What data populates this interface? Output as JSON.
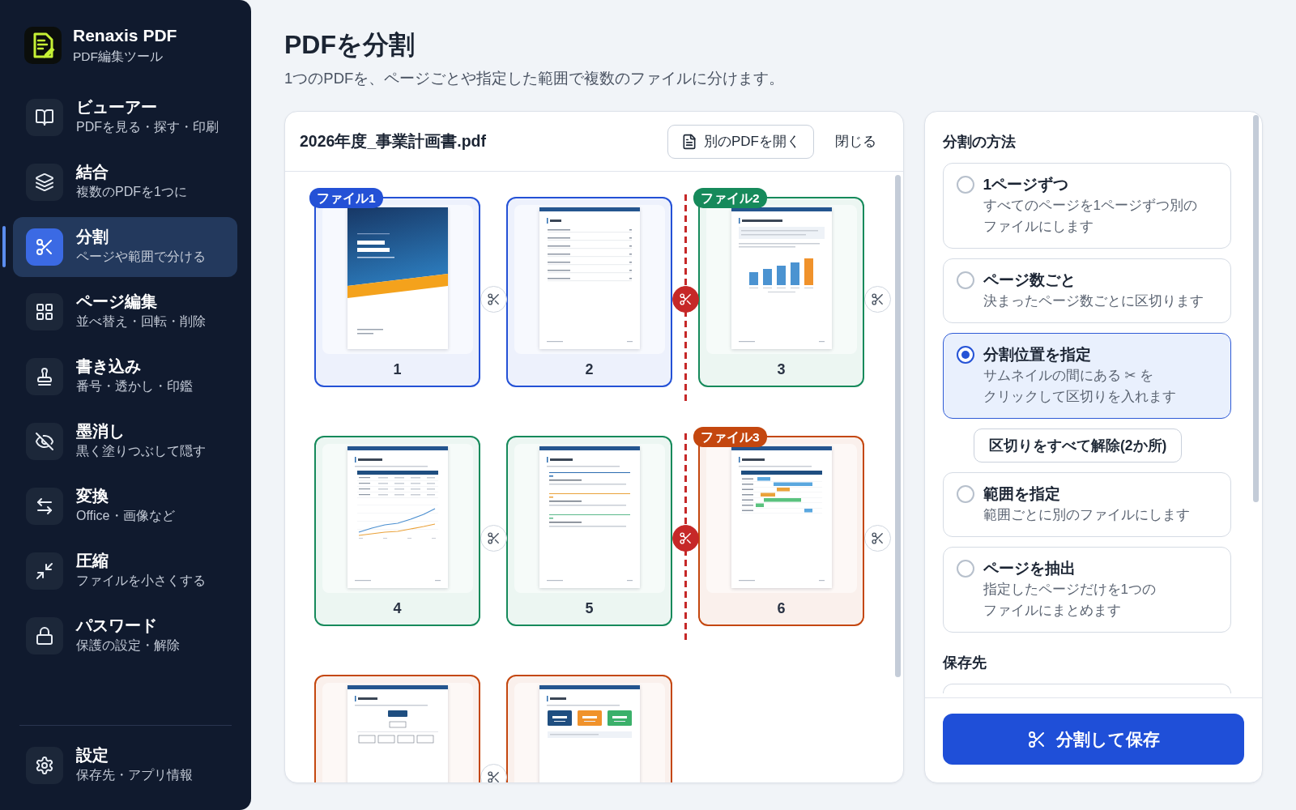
{
  "sidebar": {
    "app_name": "Renaxis PDF",
    "tagline": "PDF編集ツール",
    "items": [
      {
        "title": "ビューアー",
        "subtitle": "PDFを見る・探す・印刷",
        "selected": false
      },
      {
        "title": "結合",
        "subtitle": "複数のPDFを1つに",
        "selected": false
      },
      {
        "title": "分割",
        "subtitle": "ページや範囲で分ける",
        "selected": true
      },
      {
        "title": "ページ編集",
        "subtitle": "並べ替え・回転・削除",
        "selected": false
      },
      {
        "title": "書き込み",
        "subtitle": "番号・透かし・印鑑",
        "selected": false
      },
      {
        "title": "墨消し",
        "subtitle": "黒く塗りつぶして隠す",
        "selected": false
      },
      {
        "title": "変換",
        "subtitle": "Office・画像など",
        "selected": false
      },
      {
        "title": "圧縮",
        "subtitle": "ファイルを小さくする",
        "selected": false
      },
      {
        "title": "パスワード",
        "subtitle": "保護の設定・解除",
        "selected": false
      }
    ],
    "footer_item": {
      "title": "設定",
      "subtitle": "保存先・アプリ情報",
      "selected": false
    }
  },
  "header": {
    "title": "PDFを分割",
    "description": "1つのPDFを、ページごとや指定した範囲で複数のファイルに分けます。"
  },
  "document": {
    "file_name": "2026年度_事業計画書.pdf",
    "open_button": "別のPDFを開く",
    "close_button": "閉じる",
    "files": [
      {
        "label": "ファイル1",
        "color": "#2451d6",
        "pages": [
          {
            "number": "1",
            "kind": "cover",
            "split_after": false
          },
          {
            "number": "2",
            "kind": "contents",
            "split_after": true
          }
        ]
      },
      {
        "label": "ファイル2",
        "color": "#168a5b",
        "pages": [
          {
            "number": "3",
            "kind": "bar-chart",
            "split_after": false
          },
          {
            "number": "4",
            "kind": "table-chart",
            "split_after": false
          },
          {
            "number": "5",
            "kind": "sections",
            "split_after": true
          }
        ]
      },
      {
        "label": "ファイル3",
        "color": "#c4470f",
        "pages": [
          {
            "number": "6",
            "kind": "schedule",
            "split_after": false
          },
          {
            "kind": "org-chart",
            "split_after": false
          },
          {
            "kind": "summary"
          }
        ]
      }
    ]
  },
  "options_panel": {
    "heading": "分割の方法",
    "methods": [
      {
        "title": "1ページずつ",
        "description": "すべてのページを1ページずつ別のファイルにします",
        "selected": false
      },
      {
        "title": "ページ数ごと",
        "description": "決まったページ数ごとに区切ります",
        "selected": false
      },
      {
        "title": "分割位置を指定",
        "description": "サムネイルの間にある ✂ をクリックして区切りを入れます",
        "selected": true,
        "action": "区切りをすべて解除(2か所)"
      },
      {
        "title": "範囲を指定",
        "description": "範囲ごとに別のファイルにします",
        "selected": false
      },
      {
        "title": "ページを抽出",
        "description": "指定したページだけを1つのファイルにまとめます",
        "selected": false
      }
    ],
    "destination_heading": "保存先",
    "save_button": "分割して保存"
  }
}
